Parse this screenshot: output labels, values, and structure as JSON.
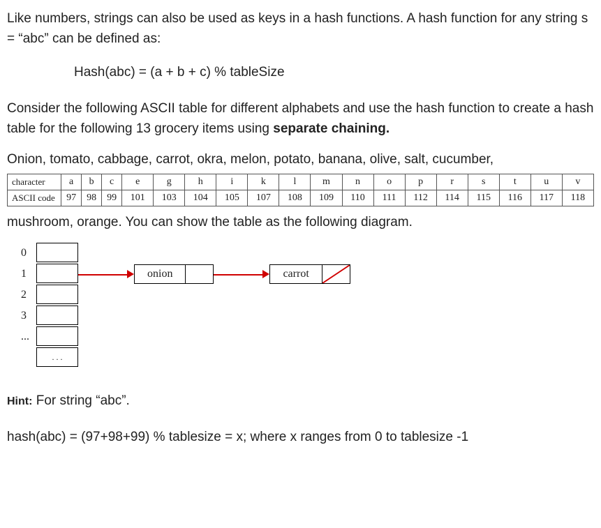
{
  "intro": {
    "line1": "Like numbers, strings can also be used as keys in a hash functions. A hash function for any string s = “abc” can be defined as:",
    "formula": "Hash(abc) = (a + b + c) % tableSize",
    "line2_a": "Consider the following ASCII table for different alphabets and use the hash function to create a hash table for the following 13 grocery items using ",
    "line2_bold": "separate chaining.",
    "items": "Onion, tomato, cabbage, carrot, okra, melon, potato, banana, olive, salt, cucumber,"
  },
  "ascii": {
    "row1_label": "character",
    "row2_label": "ASCII code",
    "chars": [
      "a",
      "b",
      "c",
      "e",
      "g",
      "h",
      "i",
      "k",
      "l",
      "m",
      "n",
      "o",
      "p",
      "r",
      "s",
      "t",
      "u",
      "v"
    ],
    "codes": [
      "97",
      "98",
      "99",
      "101",
      "103",
      "104",
      "105",
      "107",
      "108",
      "109",
      "110",
      "111",
      "112",
      "114",
      "115",
      "116",
      "117",
      "118"
    ]
  },
  "after_table": "mushroom, orange.  You can show the table as the following diagram.",
  "diagram": {
    "indices": [
      "0",
      "1",
      "2",
      "3",
      "..."
    ],
    "last_box_text": ". . .",
    "chain": {
      "node1": "onion",
      "node2": "carrot"
    }
  },
  "hint": {
    "label": "Hint:",
    "text": "For string “abc”.",
    "example": "hash(abc) = (97+98+99) % tablesize =  x; where x ranges from 0 to tablesize -1"
  }
}
